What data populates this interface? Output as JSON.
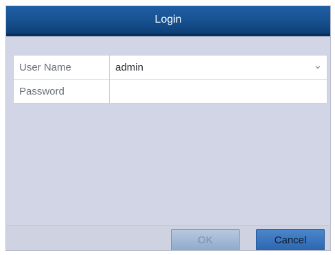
{
  "dialog": {
    "title": "Login"
  },
  "form": {
    "username": {
      "label": "User Name",
      "value": "admin",
      "icon": "chevron-down-icon"
    },
    "password": {
      "label": "Password",
      "value": ""
    }
  },
  "buttons": {
    "ok_label": "OK",
    "cancel_label": "Cancel"
  },
  "colors": {
    "titlebar": "#16508f",
    "dialog_bg": "#d1d5e6",
    "button_active": "#2b66b0",
    "button_disabled": "#8eaacc"
  }
}
